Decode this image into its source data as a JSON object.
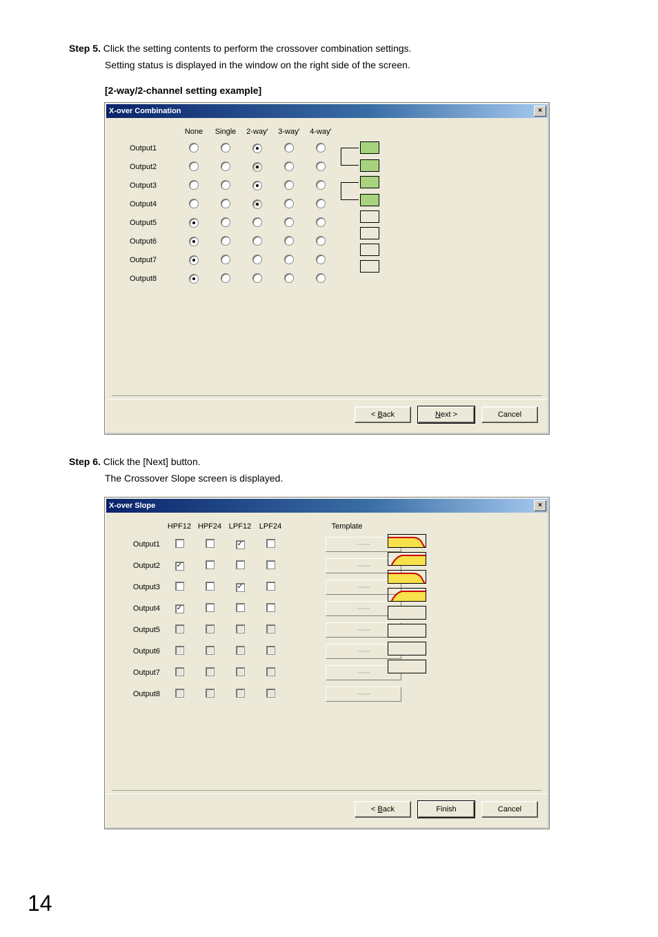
{
  "step5": {
    "label": "Step 5.",
    "line1": "Click the setting contents to perform the crossover combination settings.",
    "line2": "Setting status is displayed in the window on the right side of the screen."
  },
  "example_title": "[2-way/2-channel setting example]",
  "dialog1": {
    "title": "X-over Combination",
    "columns": [
      "None",
      "Single",
      "2-way'",
      "3-way'",
      "4-way'"
    ],
    "rows": [
      {
        "label": "Output1",
        "selected": 2,
        "disabled": []
      },
      {
        "label": "Output2",
        "selected": 2,
        "disabled": [
          2
        ]
      },
      {
        "label": "Output3",
        "selected": 2,
        "disabled": []
      },
      {
        "label": "Output4",
        "selected": 2,
        "disabled": [
          2
        ]
      },
      {
        "label": "Output5",
        "selected": 0,
        "disabled": []
      },
      {
        "label": "Output6",
        "selected": 0,
        "disabled": []
      },
      {
        "label": "Output7",
        "selected": 0,
        "disabled": []
      },
      {
        "label": "Output8",
        "selected": 0,
        "disabled": []
      }
    ],
    "preview_pairs": [
      {
        "type": "pair",
        "filled": true
      },
      {
        "type": "pair",
        "filled": true
      },
      {
        "type": "single",
        "filled": false
      },
      {
        "type": "single",
        "filled": false
      },
      {
        "type": "single",
        "filled": false
      },
      {
        "type": "single",
        "filled": false
      }
    ],
    "buttons": {
      "back": "< Back",
      "next": "Next >",
      "cancel": "Cancel"
    }
  },
  "step6": {
    "label": "Step 6.",
    "line1": "Click the [Next] button.",
    "line2": "The Crossover Slope screen is displayed."
  },
  "dialog2": {
    "title": "X-over Slope",
    "columns": [
      "HPF12",
      "HPF24",
      "LPF12",
      "LPF24",
      "Template"
    ],
    "rows": [
      {
        "label": "Output1",
        "checks": [
          false,
          false,
          true,
          false
        ],
        "enabled": true,
        "template": "-----",
        "slope": "low"
      },
      {
        "label": "Output2",
        "checks": [
          true,
          false,
          false,
          false
        ],
        "enabled": true,
        "template": "-----",
        "slope": "high"
      },
      {
        "label": "Output3",
        "checks": [
          false,
          false,
          true,
          false
        ],
        "enabled": true,
        "template": "-----",
        "slope": "low"
      },
      {
        "label": "Output4",
        "checks": [
          true,
          false,
          false,
          false
        ],
        "enabled": true,
        "template": "-----",
        "slope": "high"
      },
      {
        "label": "Output5",
        "checks": [
          false,
          false,
          false,
          false
        ],
        "enabled": false,
        "template": "-----",
        "slope": "none"
      },
      {
        "label": "Output6",
        "checks": [
          false,
          false,
          false,
          false
        ],
        "enabled": false,
        "template": "-----",
        "slope": "none"
      },
      {
        "label": "Output7",
        "checks": [
          false,
          false,
          false,
          false
        ],
        "enabled": false,
        "template": "-----",
        "slope": "none"
      },
      {
        "label": "Output8",
        "checks": [
          false,
          false,
          false,
          false
        ],
        "enabled": false,
        "template": "-----",
        "slope": "none"
      }
    ],
    "buttons": {
      "back": "< Back",
      "finish": "Finish",
      "cancel": "Cancel"
    }
  },
  "page_number": "14"
}
